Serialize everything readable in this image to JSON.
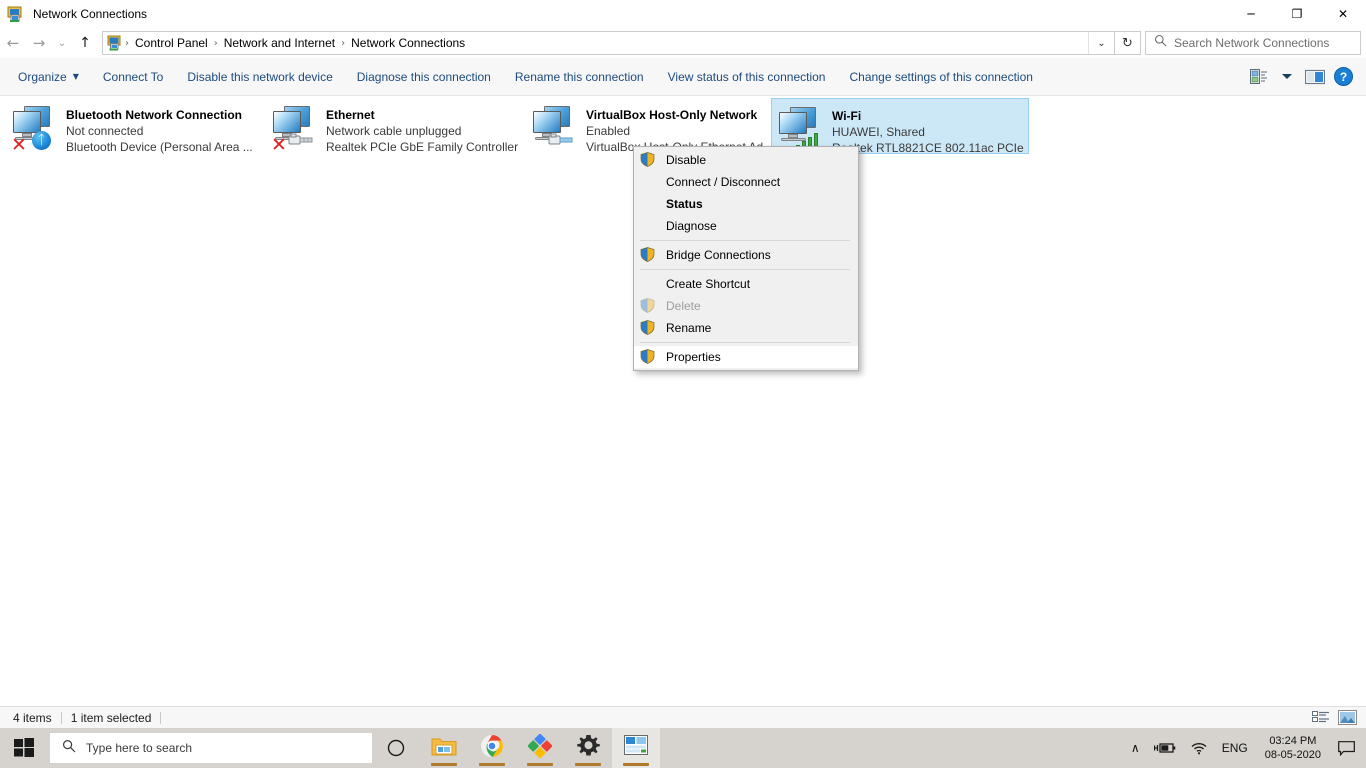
{
  "window": {
    "title": "Network Connections",
    "icon": "network-connections-icon",
    "minimize_label": "─",
    "maximize_label": "❐",
    "close_label": "✕"
  },
  "address_bar": {
    "back_label": "←",
    "forward_label": "→",
    "history_label": "⌄",
    "up_label": "↑",
    "breadcrumbs": [
      "Control Panel",
      "Network and Internet",
      "Network Connections"
    ],
    "separator": "›",
    "dropdown_label": "⌄",
    "refresh_label": "↻"
  },
  "search": {
    "placeholder": "Search Network Connections",
    "icon": "search-icon"
  },
  "command_bar": {
    "items": [
      {
        "label": "Organize",
        "has_caret": true
      },
      {
        "label": "Connect To",
        "has_caret": false
      },
      {
        "label": "Disable this network device",
        "has_caret": false
      },
      {
        "label": "Diagnose this connection",
        "has_caret": false
      },
      {
        "label": "Rename this connection",
        "has_caret": false
      },
      {
        "label": "View status of this connection",
        "has_caret": false
      },
      {
        "label": "Change settings of this connection",
        "has_caret": false
      }
    ],
    "caret": "▼",
    "right_icons": [
      "layout-options-icon",
      "layout-dropdown-caret",
      "preview-pane-icon",
      "help-icon"
    ],
    "help_label": "?"
  },
  "connections": [
    {
      "name": "Bluetooth Network Connection",
      "status": "Not connected",
      "device": "Bluetooth Device (Personal Area ...",
      "badge": "bluetooth",
      "disabled_x": true,
      "selected": false
    },
    {
      "name": "Ethernet",
      "status": "Network cable unplugged",
      "device": "Realtek PCIe GbE Family Controller",
      "badge": "cable",
      "disabled_x": true,
      "selected": false
    },
    {
      "name": "VirtualBox Host-Only Network",
      "status": "Enabled",
      "device": "VirtualBox Host-Only Ethernet Ad...",
      "badge": "cable",
      "disabled_x": false,
      "selected": false
    },
    {
      "name": "Wi-Fi",
      "status": "HUAWEI, Shared",
      "device": "Realtek RTL8821CE 802.11ac PCIe ...",
      "badge": "wifi",
      "disabled_x": false,
      "selected": true
    }
  ],
  "context_menu": {
    "items": [
      {
        "label": "Disable",
        "shield": true,
        "bold": false,
        "disabled": false,
        "highlighted": false,
        "separator_after": false
      },
      {
        "label": "Connect / Disconnect",
        "shield": false,
        "bold": false,
        "disabled": false,
        "highlighted": false,
        "separator_after": false
      },
      {
        "label": "Status",
        "shield": false,
        "bold": true,
        "disabled": false,
        "highlighted": false,
        "separator_after": false
      },
      {
        "label": "Diagnose",
        "shield": false,
        "bold": false,
        "disabled": false,
        "highlighted": false,
        "separator_after": true
      },
      {
        "label": "Bridge Connections",
        "shield": true,
        "bold": false,
        "disabled": false,
        "highlighted": false,
        "separator_after": true
      },
      {
        "label": "Create Shortcut",
        "shield": false,
        "bold": false,
        "disabled": false,
        "highlighted": false,
        "separator_after": false
      },
      {
        "label": "Delete",
        "shield": true,
        "bold": false,
        "disabled": true,
        "highlighted": false,
        "separator_after": false
      },
      {
        "label": "Rename",
        "shield": true,
        "bold": false,
        "disabled": false,
        "highlighted": false,
        "separator_after": true
      },
      {
        "label": "Properties",
        "shield": true,
        "bold": false,
        "disabled": false,
        "highlighted": true,
        "separator_after": false
      }
    ]
  },
  "status_bar": {
    "item_count": "4 items",
    "selection": "1 item selected",
    "view_details_icon": "details-view-icon",
    "view_thumbnails_icon": "large-icons-view-icon"
  },
  "taskbar": {
    "start_icon": "windows-start-icon",
    "search_placeholder": "Type here to search",
    "cortana_icon": "cortana-circle-icon",
    "apps": [
      {
        "icon": "file-explorer-icon",
        "running": true
      },
      {
        "icon": "google-chrome-icon",
        "running": true
      },
      {
        "icon": "google-drive-icon",
        "running": true
      },
      {
        "icon": "settings-gear-icon",
        "running": true
      },
      {
        "icon": "network-connections-icon",
        "running": true,
        "active": true
      }
    ],
    "tray": {
      "overflow_label": "∧",
      "battery_icon": "battery-charging-icon",
      "wifi_icon": "wifi-icon",
      "language": "ENG",
      "time": "03:24 PM",
      "date": "08-05-2020",
      "notifications_icon": "action-center-icon"
    }
  },
  "colors": {
    "accent": "#0078d7",
    "selection_bg": "#cce8f7",
    "selection_border": "#99d1f0",
    "command_link": "#1c4b7d",
    "taskbar_bg": "#d6d3ce",
    "menu_bg": "#f0f0f0"
  }
}
